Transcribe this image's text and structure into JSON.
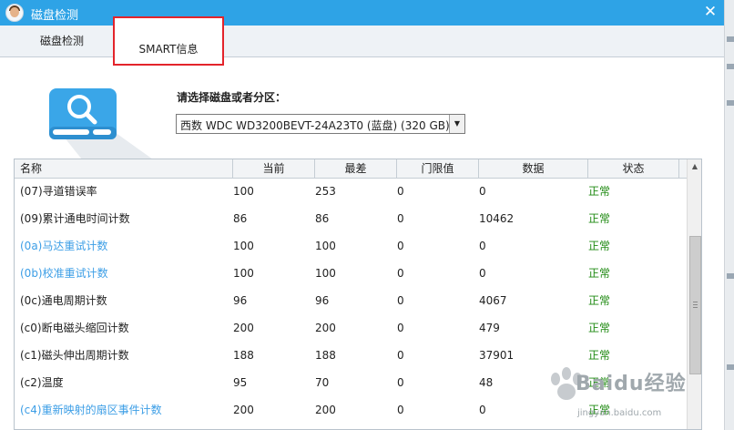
{
  "window": {
    "title": "磁盘检测",
    "close_glyph": "✕"
  },
  "tabs": [
    {
      "label": "磁盘检测",
      "active": false
    },
    {
      "label": "SMART信息",
      "active": true
    }
  ],
  "disk": {
    "select_label": "请选择磁盘或者分区：",
    "selected": "西数 WDC WD3200BEVT-24A23T0 (蓝盘)  (320 GB)"
  },
  "table": {
    "headers": [
      "名称",
      "当前",
      "最差",
      "门限值",
      "数据",
      "状态"
    ],
    "rows": [
      {
        "name": "(07)寻道错误率",
        "current": "100",
        "worst": "253",
        "threshold": "0",
        "data": "0",
        "status": "正常",
        "highlight": false
      },
      {
        "name": "(09)累计通电时间计数",
        "current": "86",
        "worst": "86",
        "threshold": "0",
        "data": "10462",
        "status": "正常",
        "highlight": false
      },
      {
        "name": "(0a)马达重试计数",
        "current": "100",
        "worst": "100",
        "threshold": "0",
        "data": "0",
        "status": "正常",
        "highlight": true
      },
      {
        "name": "(0b)校准重试计数",
        "current": "100",
        "worst": "100",
        "threshold": "0",
        "data": "0",
        "status": "正常",
        "highlight": true
      },
      {
        "name": "(0c)通电周期计数",
        "current": "96",
        "worst": "96",
        "threshold": "0",
        "data": "4067",
        "status": "正常",
        "highlight": false
      },
      {
        "name": "(c0)断电磁头缩回计数",
        "current": "200",
        "worst": "200",
        "threshold": "0",
        "data": "479",
        "status": "正常",
        "highlight": false
      },
      {
        "name": "(c1)磁头伸出周期计数",
        "current": "188",
        "worst": "188",
        "threshold": "0",
        "data": "37901",
        "status": "正常",
        "highlight": false
      },
      {
        "name": "(c2)温度",
        "current": "95",
        "worst": "70",
        "threshold": "0",
        "data": "48",
        "status": "正常",
        "highlight": false
      },
      {
        "name": "(c4)重新映射的扇区事件计数",
        "current": "200",
        "worst": "200",
        "threshold": "0",
        "data": "0",
        "status": "正常",
        "highlight": true
      }
    ]
  },
  "watermark": {
    "text": "Baidu经验",
    "sub": "jingyan.baidu.com"
  },
  "colors": {
    "titlebar": "#2ea3e6",
    "link_blue": "#3c9ee6",
    "ok_green": "#1f8a12",
    "highlight_red": "#e3242b"
  }
}
